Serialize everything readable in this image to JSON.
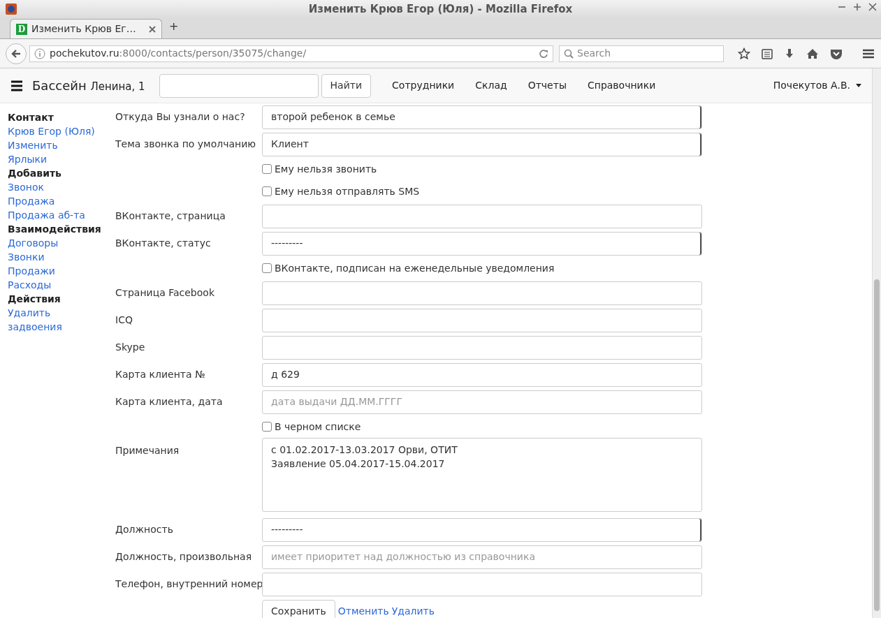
{
  "browser": {
    "title": "Изменить Крюв Егор (Юля) - Mozilla Firefox",
    "tab_title": "Изменить Крюв Ег…",
    "tab_favicon": "D",
    "new_tab": "+",
    "url_host": "pochekutov.ru",
    "url_rest": ":8000/contacts/person/35075/change/",
    "search_placeholder": "Search"
  },
  "navbar": {
    "brand": "Бассейн",
    "brand_sub": "Ленина, 1",
    "search_button": "Найти",
    "items": [
      "Сотрудники",
      "Склад",
      "Отчеты",
      "Справочники"
    ],
    "user": "Почекутов А.В."
  },
  "sidebar": [
    {
      "kind": "heading",
      "text": "Контакт"
    },
    {
      "kind": "link",
      "text": "Крюв Егор (Юля)"
    },
    {
      "kind": "link",
      "text": "Изменить"
    },
    {
      "kind": "link",
      "text": "Ярлыки"
    },
    {
      "kind": "heading",
      "text": "Добавить"
    },
    {
      "kind": "link",
      "text": "Звонок"
    },
    {
      "kind": "link",
      "text": "Продажа"
    },
    {
      "kind": "link",
      "text": "Продажа аб-та"
    },
    {
      "kind": "heading",
      "text": "Взаимодействия"
    },
    {
      "kind": "link",
      "text": "Договоры"
    },
    {
      "kind": "link",
      "text": "Звонки"
    },
    {
      "kind": "link",
      "text": "Продажи"
    },
    {
      "kind": "link",
      "text": "Расходы"
    },
    {
      "kind": "heading",
      "text": "Действия"
    },
    {
      "kind": "link",
      "text": "Удалить"
    },
    {
      "kind": "link",
      "text": "задвоения"
    }
  ],
  "form": {
    "rows": [
      {
        "kind": "select",
        "label": "Откуда Вы узнали о нас?",
        "value": "второй ребенок в семье"
      },
      {
        "kind": "select",
        "label": "Тема звонка по умолчанию",
        "value": "Клиент"
      },
      {
        "kind": "checkbox",
        "label": "Ему нельзя звонить",
        "checked": false
      },
      {
        "kind": "checkbox",
        "label": "Ему нельзя отправлять SMS",
        "checked": false
      },
      {
        "kind": "text",
        "label": "ВКонтакте, страница"
      },
      {
        "kind": "select",
        "label": "ВКонтакте, статус",
        "value": "---------"
      },
      {
        "kind": "checkbox",
        "label": "ВКонтакте, подписан на еженедельные уведомления",
        "checked": false
      },
      {
        "kind": "text",
        "label": "Страница Facebook"
      },
      {
        "kind": "text",
        "label": "ICQ"
      },
      {
        "kind": "text",
        "label": "Skype"
      },
      {
        "kind": "text",
        "label": "Карта клиента №",
        "value": "д 629"
      },
      {
        "kind": "text",
        "label": "Карта клиента, дата",
        "placeholder": "дата выдачи ДД.ММ.ГГГГ"
      },
      {
        "kind": "checkbox",
        "label": "В черном списке",
        "checked": false
      },
      {
        "kind": "textarea",
        "label": "Примечания",
        "value": "с 01.02.2017-13.03.2017 Орви, ОТИТ\nЗаявление 05.04.2017-15.04.2017"
      },
      {
        "kind": "select",
        "label": "Должность",
        "value": "---------"
      },
      {
        "kind": "text",
        "label": "Должность, произвольная",
        "placeholder": "имеет приоритет над должностью из справочника"
      },
      {
        "kind": "text",
        "label": "Телефон, внутренний номер"
      }
    ],
    "save_button": "Сохранить",
    "links": [
      "Отменить",
      "Удалить"
    ]
  }
}
